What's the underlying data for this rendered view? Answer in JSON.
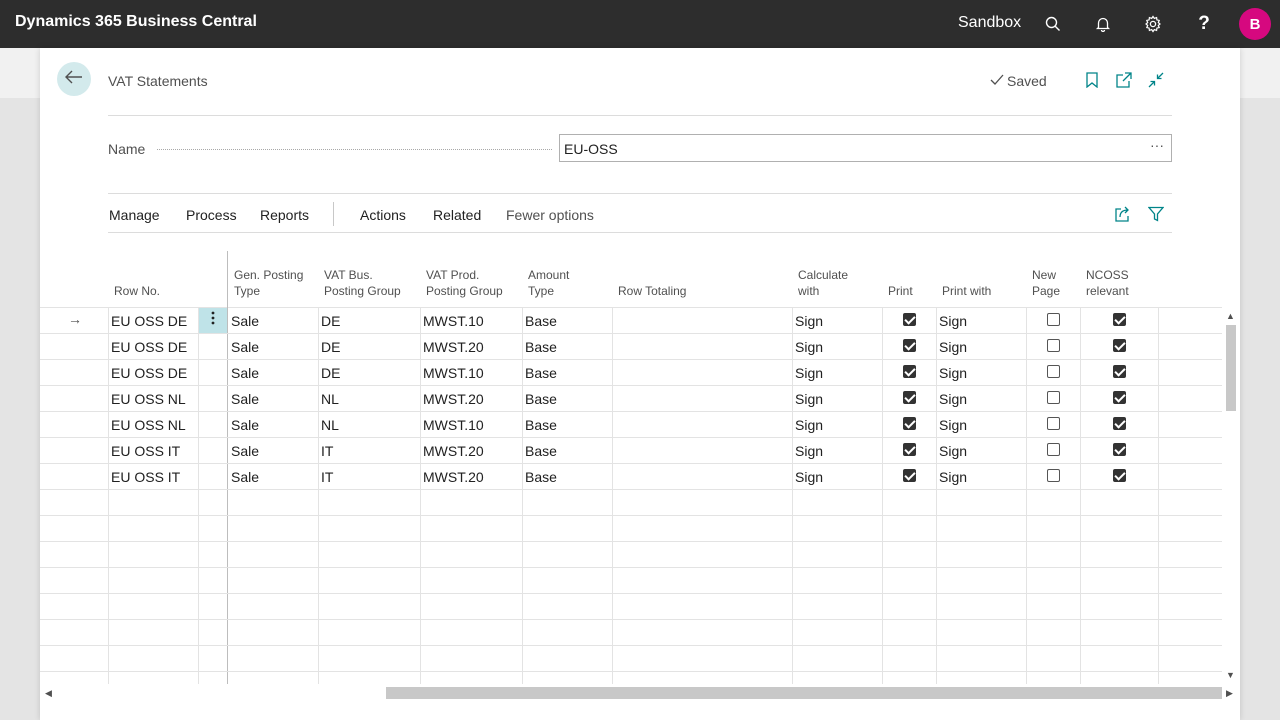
{
  "topbar": {
    "app_title": "Dynamics 365 Business Central",
    "environment": "Sandbox",
    "avatar_initial": "B",
    "help_label": "?"
  },
  "page": {
    "title": "VAT Statements",
    "saved_label": "Saved"
  },
  "name_field": {
    "label": "Name",
    "value": "EU-OSS",
    "more_label": "···"
  },
  "actions": {
    "manage": "Manage",
    "process": "Process",
    "reports": "Reports",
    "actions": "Actions",
    "related": "Related",
    "fewer_options": "Fewer options"
  },
  "columns": {
    "row_no": "Row No.",
    "gen_posting_type": [
      "Gen. Posting",
      "Type"
    ],
    "vat_bus": [
      "VAT Bus.",
      "Posting Group"
    ],
    "vat_prod": [
      "VAT Prod.",
      "Posting Group"
    ],
    "amount_type": [
      "Amount",
      "Type"
    ],
    "row_totaling": "Row Totaling",
    "calculate_with": [
      "Calculate",
      "with"
    ],
    "print": "Print",
    "print_with": "Print with",
    "new_page": [
      "New",
      "Page"
    ],
    "ncoss": [
      "NCOSS",
      "relevant"
    ]
  },
  "rows": [
    {
      "row_no": "EU OSS DE",
      "gen_posting_type": "Sale",
      "vat_bus": "DE",
      "vat_prod": "MWST.10",
      "amount_type": "Base",
      "row_totaling": "",
      "calculate_with": "Sign",
      "print": true,
      "print_with": "Sign",
      "new_page": false,
      "ncoss": true
    },
    {
      "row_no": "EU OSS DE",
      "gen_posting_type": "Sale",
      "vat_bus": "DE",
      "vat_prod": "MWST.20",
      "amount_type": "Base",
      "row_totaling": "",
      "calculate_with": "Sign",
      "print": true,
      "print_with": "Sign",
      "new_page": false,
      "ncoss": true
    },
    {
      "row_no": "EU OSS DE",
      "gen_posting_type": "Sale",
      "vat_bus": "DE",
      "vat_prod": "MWST.10",
      "amount_type": "Base",
      "row_totaling": "",
      "calculate_with": "Sign",
      "print": true,
      "print_with": "Sign",
      "new_page": false,
      "ncoss": true
    },
    {
      "row_no": "EU OSS NL",
      "gen_posting_type": "Sale",
      "vat_bus": "NL",
      "vat_prod": "MWST.20",
      "amount_type": "Base",
      "row_totaling": "",
      "calculate_with": "Sign",
      "print": true,
      "print_with": "Sign",
      "new_page": false,
      "ncoss": true
    },
    {
      "row_no": "EU OSS NL",
      "gen_posting_type": "Sale",
      "vat_bus": "NL",
      "vat_prod": "MWST.10",
      "amount_type": "Base",
      "row_totaling": "",
      "calculate_with": "Sign",
      "print": true,
      "print_with": "Sign",
      "new_page": false,
      "ncoss": true
    },
    {
      "row_no": "EU OSS IT",
      "gen_posting_type": "Sale",
      "vat_bus": "IT",
      "vat_prod": "MWST.20",
      "amount_type": "Base",
      "row_totaling": "",
      "calculate_with": "Sign",
      "print": true,
      "print_with": "Sign",
      "new_page": false,
      "ncoss": true
    },
    {
      "row_no": "EU OSS IT",
      "gen_posting_type": "Sale",
      "vat_bus": "IT",
      "vat_prod": "MWST.20",
      "amount_type": "Base",
      "row_totaling": "",
      "calculate_with": "Sign",
      "print": true,
      "print_with": "Sign",
      "new_page": false,
      "ncoss": true
    }
  ],
  "empty_row_count": 7,
  "colors": {
    "topbar": "#2d2d2d",
    "avatar": "#d6087f",
    "accent": "#008489",
    "selected_cell": "#bfe3e8"
  }
}
